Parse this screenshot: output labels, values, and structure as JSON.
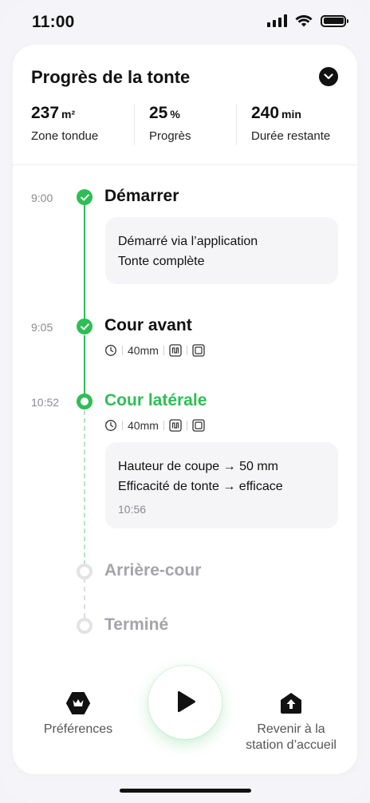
{
  "status_bar": {
    "time": "11:00"
  },
  "card": {
    "title": "Progrès de la tonte",
    "stats": [
      {
        "value": "237",
        "unit": "m²",
        "label": "Zone tondue"
      },
      {
        "value": "25",
        "unit": "%",
        "label": "Progrès"
      },
      {
        "value": "240",
        "unit": "min",
        "label": "Durée restante"
      }
    ]
  },
  "timeline": [
    {
      "time": "9:00",
      "title": "Démarrer",
      "state": "done",
      "note": [
        "Démarré via l’application",
        "Tonte complète"
      ]
    },
    {
      "time": "9:05",
      "title": "Cour avant",
      "state": "done",
      "meta": {
        "height": "40mm"
      }
    },
    {
      "time": "10:52",
      "title": "Cour latérale",
      "state": "active",
      "meta": {
        "height": "40mm"
      },
      "note": [
        "Hauteur de coupe → 50 mm",
        "Efficacité de tonte → efficace"
      ],
      "note_time": "10:56"
    },
    {
      "time": "",
      "title": "Arrière-cour",
      "state": "pending"
    },
    {
      "time": "",
      "title": "Terminé",
      "state": "pending"
    }
  ],
  "bottom_nav": {
    "preferences_label": "Préférences",
    "return_label_line1": "Revenir à la",
    "return_label_line2": "station d’accueil",
    "play_icon": "play-icon"
  },
  "colors": {
    "accent": "#2fbe55",
    "pending": "#a4a4a9"
  }
}
